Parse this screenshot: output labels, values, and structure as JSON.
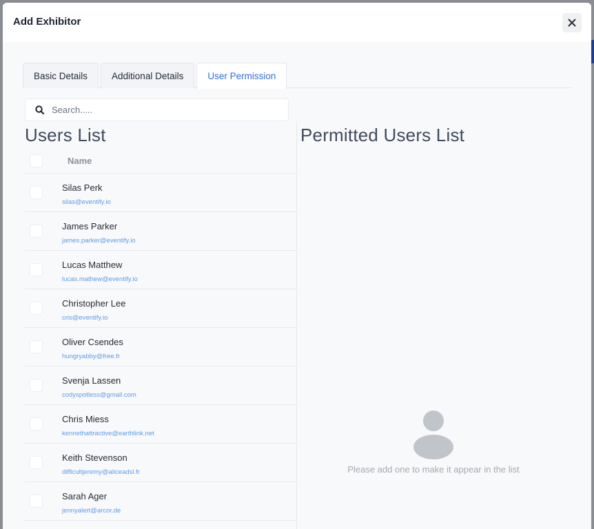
{
  "modal": {
    "title": "Add Exhibitor",
    "close_icon": "close-icon"
  },
  "tabs": [
    {
      "label": "Basic Details",
      "active": false
    },
    {
      "label": "Additional Details",
      "active": false
    },
    {
      "label": "User Permission",
      "active": true
    }
  ],
  "search": {
    "placeholder": "Search.....",
    "value": "",
    "icon": "search-icon"
  },
  "users_list": {
    "title": "Users List",
    "column_header": "Name",
    "users": [
      {
        "name": "Silas Perk",
        "email": "silas@eventify.io",
        "checked": false
      },
      {
        "name": "James Parker",
        "email": "james.parker@eventify.io",
        "checked": false
      },
      {
        "name": "Lucas Matthew",
        "email": "lucas.mathew@eventify.io",
        "checked": false
      },
      {
        "name": "Christopher Lee",
        "email": "cris@eventify.io",
        "checked": false
      },
      {
        "name": "Oliver Csendes",
        "email": "hungryabby@free.fr",
        "checked": false
      },
      {
        "name": "Svenja Lassen",
        "email": "codyspotless@gmail.com",
        "checked": false
      },
      {
        "name": "Chris Miess",
        "email": "kennethattractive@earthlink.net",
        "checked": false
      },
      {
        "name": "Keith Stevenson",
        "email": "difficultjeremy@aliceadsl.fr",
        "checked": false
      },
      {
        "name": "Sarah Ager",
        "email": "jennyalert@arcor.de",
        "checked": false
      }
    ]
  },
  "permitted_list": {
    "title": "Permitted Users List",
    "empty_icon": "user-placeholder-icon",
    "empty_message": "Please add one to make it appear in the list"
  },
  "colors": {
    "accent": "#2f6fe0",
    "email_link": "#5a9be8",
    "heading": "#404a5e",
    "empty_icon": "#c0c5cb"
  }
}
